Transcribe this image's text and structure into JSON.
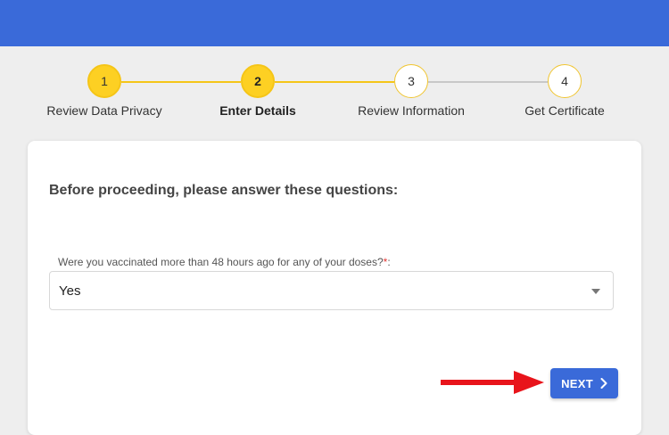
{
  "stepper": {
    "steps": [
      {
        "number": "1",
        "label": "Review Data Privacy",
        "state": "done"
      },
      {
        "number": "2",
        "label": "Enter Details",
        "state": "active"
      },
      {
        "number": "3",
        "label": "Review Information",
        "state": "todo"
      },
      {
        "number": "4",
        "label": "Get Certificate",
        "state": "todo"
      }
    ],
    "colors": {
      "active": "#fdd023",
      "line_done": "#f5c518",
      "line_todo": "#c8c8c8"
    }
  },
  "form": {
    "title": "Before proceeding, please answer these questions:",
    "question": {
      "label": "Were you vaccinated more than 48 hours ago for any of your doses?",
      "required_mark": "*",
      "suffix": ":",
      "selected_value": "Yes"
    },
    "next_button": {
      "label": "NEXT",
      "icon": "chevron-right-icon"
    }
  },
  "annotation": {
    "icon": "red-arrow-icon",
    "color": "#e8141b"
  },
  "theme": {
    "header_color": "#3a6ad9",
    "background": "#eeeeee"
  }
}
